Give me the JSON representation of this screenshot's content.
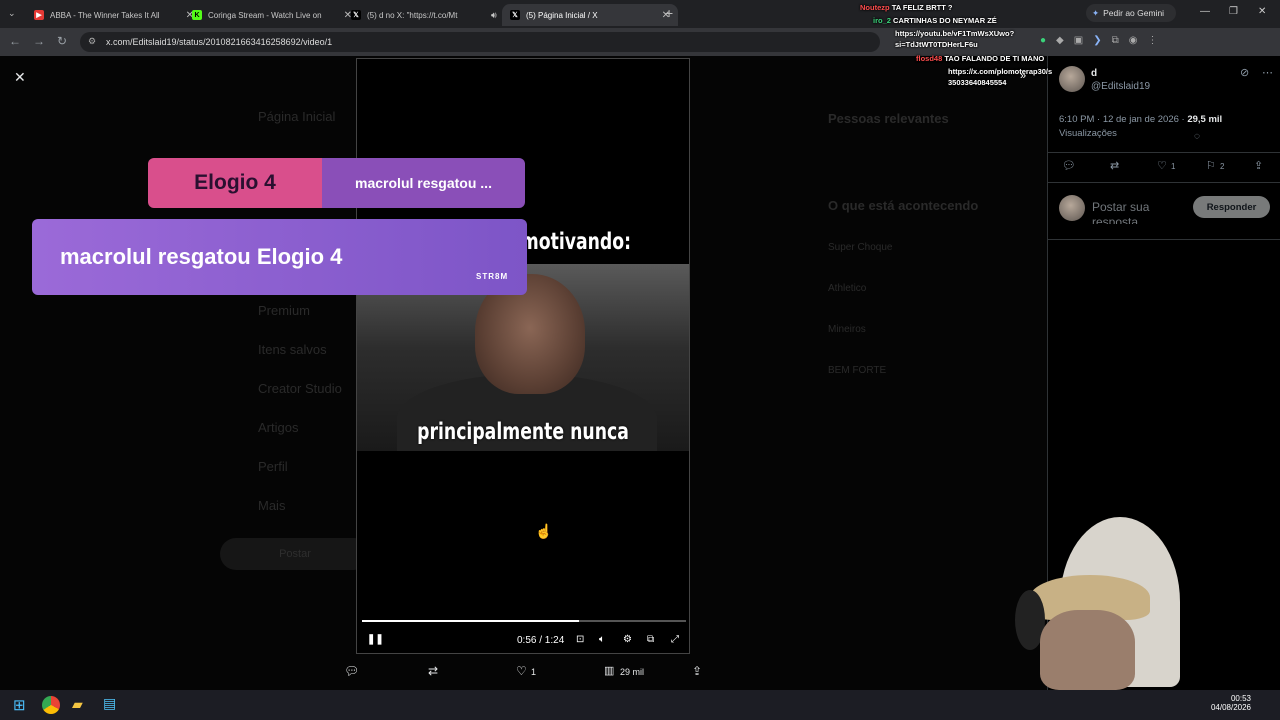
{
  "browser": {
    "tabs": [
      {
        "title": "ABBA - The Winner Takes It All",
        "favicon_color": "#e53935"
      },
      {
        "title": "Coringa Stream - Watch Live on",
        "favicon_color": "#53fc18"
      },
      {
        "title": "(5) d no X: \"https://t.co/Mt",
        "favicon_color": "#000000"
      },
      {
        "title": "(5) Página Inicial / X",
        "favicon_color": "#000000"
      }
    ],
    "url": "x.com/Editslaid19/status/2010821663416258692/video/1",
    "gemini_label": "Pedir ao Gemini"
  },
  "overlay": {
    "card1_left": "Elogio 4",
    "card1_right": "macrolul resgatou ...",
    "card2": "macrolul resgatou Elogio 4",
    "badge": "STR8M"
  },
  "video": {
    "caption_top": "homem se motivando:",
    "caption_bottom": "principalmente nunca",
    "time": "0:56 / 1:24",
    "progress_fraction": 0.67
  },
  "action_bar": {
    "likes": "1",
    "views": "29 mil"
  },
  "post": {
    "name": "d",
    "handle": "@Editslaid19",
    "time": "6:10 PM · 12 de jan de 2026 · ",
    "views": "29,5 mil",
    "views_label": "Visualizações",
    "likes": "1",
    "bookmarks": "2",
    "reply_placeholder": "Postar sua resposta",
    "reply_button": "Responder"
  },
  "background_ui": {
    "sidebar": [
      "Página Inicial",
      "Premium",
      "Itens salvos",
      "Creator Studio",
      "Artigos",
      "Perfil",
      "Mais"
    ],
    "post_button": "Postar",
    "relevant_people": "Pessoas relevantes",
    "whats_happening": "O que está acontecendo",
    "trends": [
      "Super Choque",
      "Athletico",
      "Mineiros",
      "BEM FORTE"
    ]
  },
  "chat": [
    {
      "user": "Noutezp",
      "msg": "TA FELIZ BRTT ?",
      "user_color": "#ff4d4d"
    },
    {
      "user": "iro_2",
      "msg": "CARTINHAS DO NEYMAR ZÉ",
      "user_color": "#3ad27a"
    },
    {
      "user": "",
      "msg": "https://youtu.be/vF1TmWsXUwo?",
      "user_color": "#ffffff"
    },
    {
      "user": "",
      "msg": "si=TdJtWT0TDHerLF6u",
      "user_color": "#ffffff"
    },
    {
      "user": "flosd48",
      "msg": "TAO FALANDO DE TI MANO",
      "user_color": "#ff4d4d"
    },
    {
      "user": "",
      "msg": "https://x.com/plomoterap30/s",
      "user_color": "#ffffff"
    },
    {
      "user": "",
      "msg": "35033640845554",
      "user_color": "#ffffff"
    }
  ],
  "taskbar": {
    "time": "00:53",
    "date": "04/08/2026"
  }
}
